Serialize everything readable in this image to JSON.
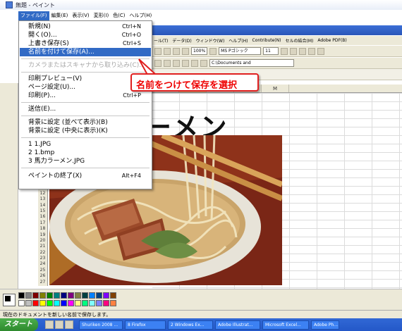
{
  "window": {
    "title": "無題 - ペイント"
  },
  "menubar": [
    {
      "label": "ファイル(F)",
      "active": true
    },
    {
      "label": "編集(E)"
    },
    {
      "label": "表示(V)"
    },
    {
      "label": "変形(I)"
    },
    {
      "label": "色(C)"
    },
    {
      "label": "ヘルプ(H)"
    }
  ],
  "file_menu": {
    "items": [
      {
        "label": "新規(N)",
        "shortcut": "Ctrl+N"
      },
      {
        "label": "開く(O)...",
        "shortcut": "Ctrl+O"
      },
      {
        "label": "上書き保存(S)",
        "shortcut": "Ctrl+S"
      },
      {
        "label": "名前を付けて保存(A)...",
        "shortcut": "",
        "highlighted": true
      },
      {
        "label": "カメラまたはスキャナから取り込み(C)...",
        "shortcut": "",
        "disabled": true
      },
      {
        "label": "印刷プレビュー(V)",
        "shortcut": ""
      },
      {
        "label": "ページ設定(U)...",
        "shortcut": ""
      },
      {
        "label": "印刷(P)...",
        "shortcut": "Ctrl+P"
      },
      {
        "label": "送信(E)...",
        "shortcut": ""
      },
      {
        "label": "背景に設定 (並べて表示)(B)",
        "shortcut": ""
      },
      {
        "label": "背景に設定 (中央に表示)(K)",
        "shortcut": ""
      },
      {
        "label": "1 1.JPG",
        "shortcut": ""
      },
      {
        "label": "2 1.bmp",
        "shortcut": ""
      },
      {
        "label": "3 馬力ラーメン.JPG",
        "shortcut": ""
      },
      {
        "label": "ペイントの終了(X)",
        "shortcut": "Alt+F4"
      }
    ]
  },
  "callout": {
    "text": "名前をつけて保存を選択"
  },
  "canvas_heading": "ーメン",
  "excel": {
    "menubar": [
      "ール(T)",
      "データ(D)",
      "ウィンドウ(W)",
      "ヘルプ(H)",
      "Contribute(N)",
      "セルの結合(M)",
      "Adobe PDF(B)"
    ],
    "font_name": "MS Pゴシック",
    "font_size": "11",
    "zoom": "100%",
    "address": "C:\\Documents and",
    "columns": [
      "I",
      "J",
      "K",
      "L",
      "M"
    ],
    "selected_column": "J"
  },
  "row_numbers": [
    "10",
    "11",
    "12",
    "13",
    "14",
    "15",
    "16",
    "17",
    "18",
    "19",
    "20",
    "21",
    "22",
    "23",
    "24",
    "25",
    "26",
    "27"
  ],
  "palette_colors": [
    "#000000",
    "#808080",
    "#800000",
    "#808000",
    "#008000",
    "#008080",
    "#000080",
    "#800080",
    "#808040",
    "#004040",
    "#0080ff",
    "#004080",
    "#8000ff",
    "#804000",
    "#ffffff",
    "#c0c0c0",
    "#ff0000",
    "#ffff00",
    "#00ff00",
    "#00ffff",
    "#0000ff",
    "#ff00ff",
    "#ffff80",
    "#00ff80",
    "#80ffff",
    "#8080ff",
    "#ff0080",
    "#ff8040"
  ],
  "status_text": "現在のドキュメントを新しい名前で保存します。",
  "taskbar": {
    "start_label": "スタート",
    "tasks": [
      "Shuriken 2008 ...",
      "8 Firefox",
      "2 Windows Ex...",
      "Adobe Illustrat...",
      "Microsoft Excel...",
      "Adobe Ph..."
    ]
  }
}
